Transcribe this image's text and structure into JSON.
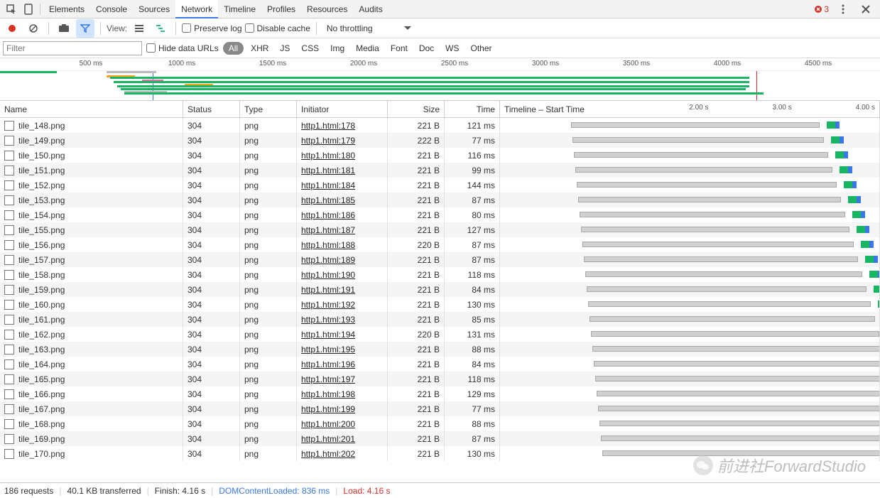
{
  "top_tabs": [
    "Elements",
    "Console",
    "Sources",
    "Network",
    "Timeline",
    "Profiles",
    "Resources",
    "Audits"
  ],
  "active_tab": "Network",
  "error_count": "3",
  "toolbar": {
    "view_label": "View:",
    "preserve_log": "Preserve log",
    "disable_cache": "Disable cache",
    "throttling": "No throttling"
  },
  "filter": {
    "placeholder": "Filter",
    "hide_data_urls": "Hide data URLs",
    "types": [
      "All",
      "XHR",
      "JS",
      "CSS",
      "Img",
      "Media",
      "Font",
      "Doc",
      "WS",
      "Other"
    ],
    "active_type": "All"
  },
  "overview_ruler": [
    "500 ms",
    "1000 ms",
    "1500 ms",
    "2000 ms",
    "2500 ms",
    "3000 ms",
    "3500 ms",
    "4000 ms",
    "4500 ms"
  ],
  "columns": {
    "name": "Name",
    "status": "Status",
    "type": "Type",
    "initiator": "Initiator",
    "size": "Size",
    "time": "Time",
    "timeline": "Timeline – Start Time"
  },
  "timeline_ticks": [
    "2.00 s",
    "3.00 s",
    "4.00 s"
  ],
  "rows": [
    {
      "name": "tile_148.png",
      "status": "304",
      "type": "png",
      "initiator": "http1.html:178",
      "size": "221 B",
      "time": "121 ms"
    },
    {
      "name": "tile_149.png",
      "status": "304",
      "type": "png",
      "initiator": "http1.html:179",
      "size": "222 B",
      "time": "77 ms"
    },
    {
      "name": "tile_150.png",
      "status": "304",
      "type": "png",
      "initiator": "http1.html:180",
      "size": "221 B",
      "time": "116 ms"
    },
    {
      "name": "tile_151.png",
      "status": "304",
      "type": "png",
      "initiator": "http1.html:181",
      "size": "221 B",
      "time": "99 ms"
    },
    {
      "name": "tile_152.png",
      "status": "304",
      "type": "png",
      "initiator": "http1.html:184",
      "size": "221 B",
      "time": "144 ms"
    },
    {
      "name": "tile_153.png",
      "status": "304",
      "type": "png",
      "initiator": "http1.html:185",
      "size": "221 B",
      "time": "87 ms"
    },
    {
      "name": "tile_154.png",
      "status": "304",
      "type": "png",
      "initiator": "http1.html:186",
      "size": "221 B",
      "time": "80 ms"
    },
    {
      "name": "tile_155.png",
      "status": "304",
      "type": "png",
      "initiator": "http1.html:187",
      "size": "221 B",
      "time": "127 ms"
    },
    {
      "name": "tile_156.png",
      "status": "304",
      "type": "png",
      "initiator": "http1.html:188",
      "size": "220 B",
      "time": "87 ms"
    },
    {
      "name": "tile_157.png",
      "status": "304",
      "type": "png",
      "initiator": "http1.html:189",
      "size": "221 B",
      "time": "87 ms"
    },
    {
      "name": "tile_158.png",
      "status": "304",
      "type": "png",
      "initiator": "http1.html:190",
      "size": "221 B",
      "time": "118 ms"
    },
    {
      "name": "tile_159.png",
      "status": "304",
      "type": "png",
      "initiator": "http1.html:191",
      "size": "221 B",
      "time": "84 ms"
    },
    {
      "name": "tile_160.png",
      "status": "304",
      "type": "png",
      "initiator": "http1.html:192",
      "size": "221 B",
      "time": "130 ms"
    },
    {
      "name": "tile_161.png",
      "status": "304",
      "type": "png",
      "initiator": "http1.html:193",
      "size": "221 B",
      "time": "85 ms"
    },
    {
      "name": "tile_162.png",
      "status": "304",
      "type": "png",
      "initiator": "http1.html:194",
      "size": "220 B",
      "time": "131 ms"
    },
    {
      "name": "tile_163.png",
      "status": "304",
      "type": "png",
      "initiator": "http1.html:195",
      "size": "221 B",
      "time": "88 ms"
    },
    {
      "name": "tile_164.png",
      "status": "304",
      "type": "png",
      "initiator": "http1.html:196",
      "size": "221 B",
      "time": "84 ms"
    },
    {
      "name": "tile_165.png",
      "status": "304",
      "type": "png",
      "initiator": "http1.html:197",
      "size": "221 B",
      "time": "118 ms"
    },
    {
      "name": "tile_166.png",
      "status": "304",
      "type": "png",
      "initiator": "http1.html:198",
      "size": "221 B",
      "time": "129 ms"
    },
    {
      "name": "tile_167.png",
      "status": "304",
      "type": "png",
      "initiator": "http1.html:199",
      "size": "221 B",
      "time": "77 ms"
    },
    {
      "name": "tile_168.png",
      "status": "304",
      "type": "png",
      "initiator": "http1.html:200",
      "size": "221 B",
      "time": "88 ms"
    },
    {
      "name": "tile_169.png",
      "status": "304",
      "type": "png",
      "initiator": "http1.html:201",
      "size": "221 B",
      "time": "87 ms"
    },
    {
      "name": "tile_170.png",
      "status": "304",
      "type": "png",
      "initiator": "http1.html:202",
      "size": "221 B",
      "time": "130 ms"
    }
  ],
  "status_bar": {
    "requests": "186 requests",
    "transferred": "40.1 KB transferred",
    "finish": "Finish: 4.16 s",
    "dcl": "DOMContentLoaded: 836 ms",
    "load": "Load: 4.16 s"
  },
  "watermark": "前进社ForwardStudio"
}
